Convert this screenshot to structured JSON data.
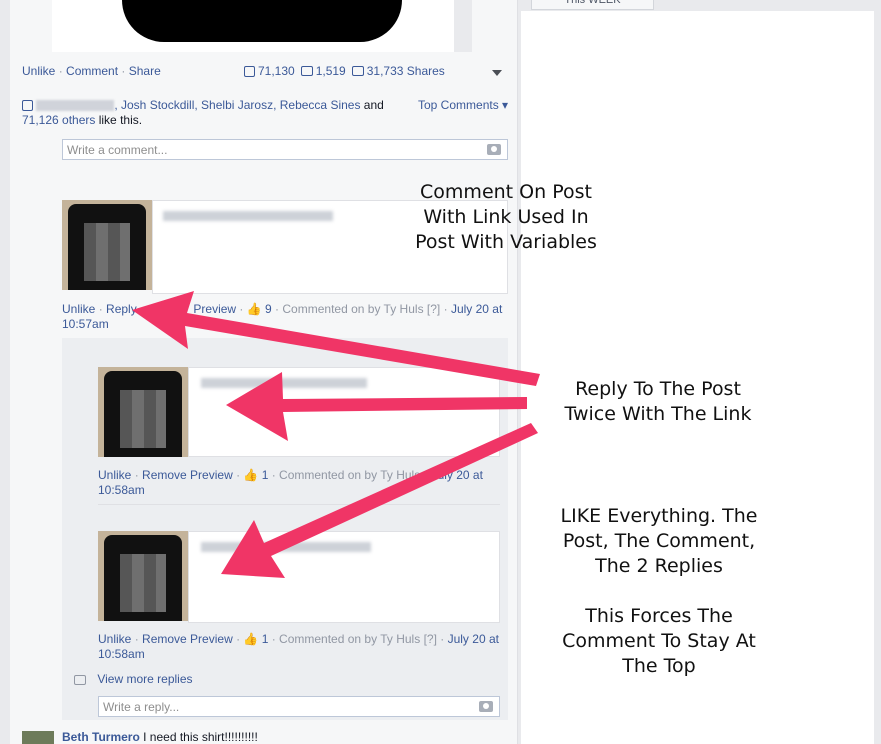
{
  "right": {
    "tab_label": "This WEEK"
  },
  "post_actions": {
    "unlike": "Unlike",
    "comment": "Comment",
    "share": "Share",
    "likes": "71,130",
    "comments": "1,519",
    "shares": "31,733 Shares"
  },
  "likers": {
    "names": ", Josh Stockdill, Shelbi Jarosz, Rebecca Sines",
    "and": " and",
    "others": "71,126 others",
    "suffix": " like this.",
    "top_comments": "Top Comments"
  },
  "comment_input": {
    "placeholder": "Write a comment..."
  },
  "comment": {
    "unlike": "Unlike",
    "reply": "Reply",
    "remove_preview": "Preview",
    "likes": "9",
    "commented_on": "Commented on by Ty Huls",
    "bracket": "[?]",
    "date": "July 20 at",
    "time": "10:57am"
  },
  "reply1": {
    "unlike": "Unlike",
    "remove_preview": "Remove Preview",
    "likes": "1",
    "commented_on": "Commented on by Ty Huls",
    "date": "July 20 at",
    "time": "10:58am"
  },
  "reply2": {
    "unlike": "Unlike",
    "remove_preview": "Remove Preview",
    "likes": "1",
    "commented_on": "Commented on by Ty Huls",
    "bracket": "[?]",
    "date": "July 20 at",
    "time": "10:58am"
  },
  "view_more": "View more replies",
  "reply_input": {
    "placeholder": "Write a reply..."
  },
  "next_comment": {
    "author": "Beth Turmero",
    "text": " I need this shirt!!!!!!!!!!"
  },
  "annotations": {
    "a1": "Comment On Post\nWith Link Used In\nPost With Variables",
    "a2": "Reply To The Post\nTwice With The Link",
    "a3": "LIKE Everything. The\nPost, The Comment,\nThe 2 Replies\n\nThis Forces The\nComment To Stay At\nThe Top"
  },
  "colors": {
    "arrow": "#f03566",
    "link": "#3b5998"
  }
}
